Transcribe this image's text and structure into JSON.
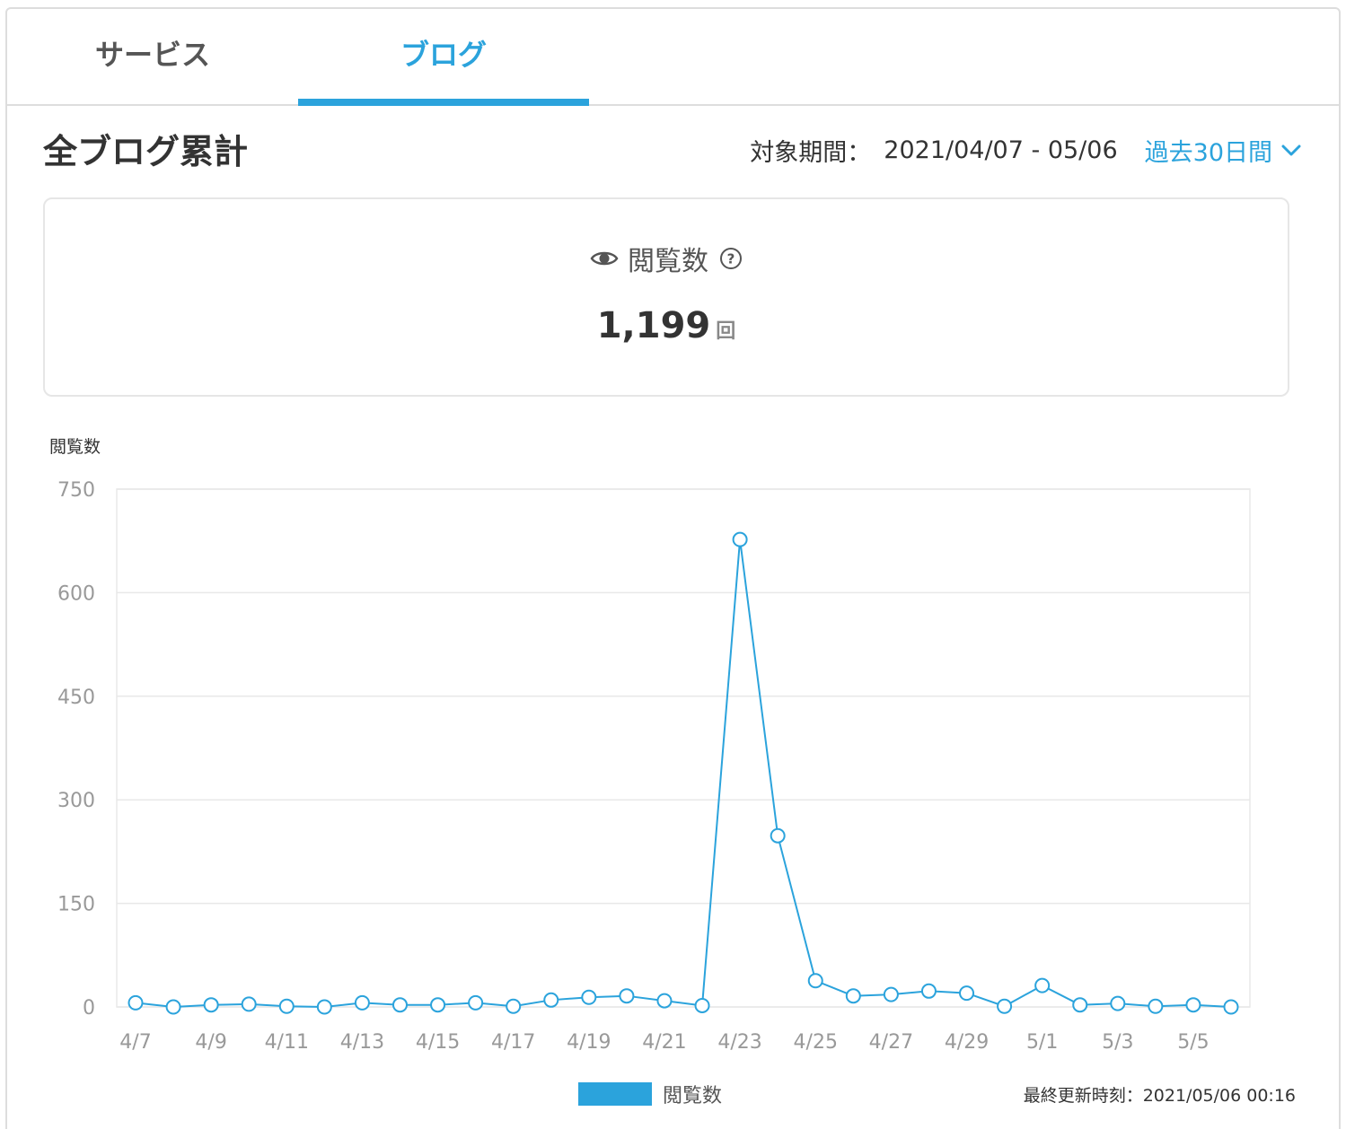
{
  "tabs": [
    {
      "label": "サービス",
      "active": false
    },
    {
      "label": "ブログ",
      "active": true
    }
  ],
  "header": {
    "title": "全ブログ累計",
    "period_label": "対象期間：",
    "period_range": "2021/04/07 - 05/06",
    "period_selector": "過去30日間"
  },
  "summary": {
    "metric_label": "閲覧数",
    "value": "1,199",
    "unit": "回"
  },
  "colors": {
    "accent": "#2ba3dc",
    "grid": "#e8e8e8",
    "tick_text": "#999999"
  },
  "chart_data": {
    "type": "line",
    "ylabel": "閲覧数",
    "ylim": [
      0,
      750
    ],
    "yticks": [
      0,
      150,
      300,
      450,
      600,
      750
    ],
    "x": [
      "4/7",
      "4/8",
      "4/9",
      "4/10",
      "4/11",
      "4/12",
      "4/13",
      "4/14",
      "4/15",
      "4/16",
      "4/17",
      "4/18",
      "4/19",
      "4/20",
      "4/21",
      "4/22",
      "4/23",
      "4/24",
      "4/25",
      "4/26",
      "4/27",
      "4/28",
      "4/29",
      "4/30",
      "5/1",
      "5/2",
      "5/3",
      "5/4",
      "5/5",
      "5/6"
    ],
    "xtick_labels": [
      "4/7",
      "4/9",
      "4/11",
      "4/13",
      "4/15",
      "4/17",
      "4/19",
      "4/21",
      "4/23",
      "4/25",
      "4/27",
      "4/29",
      "5/1",
      "5/3",
      "5/5"
    ],
    "series": [
      {
        "name": "閲覧数",
        "color": "#2ba3dc",
        "values": [
          6,
          0,
          3,
          4,
          1,
          0,
          6,
          3,
          3,
          6,
          1,
          10,
          14,
          16,
          9,
          2,
          677,
          248,
          38,
          16,
          18,
          23,
          20,
          1,
          31,
          3,
          5,
          1,
          3,
          0
        ]
      }
    ],
    "legend": {
      "position": "bottom",
      "label": "閲覧数"
    },
    "grid": true
  },
  "footer": {
    "updated": "最終更新時刻：2021/05/06 00:16"
  }
}
